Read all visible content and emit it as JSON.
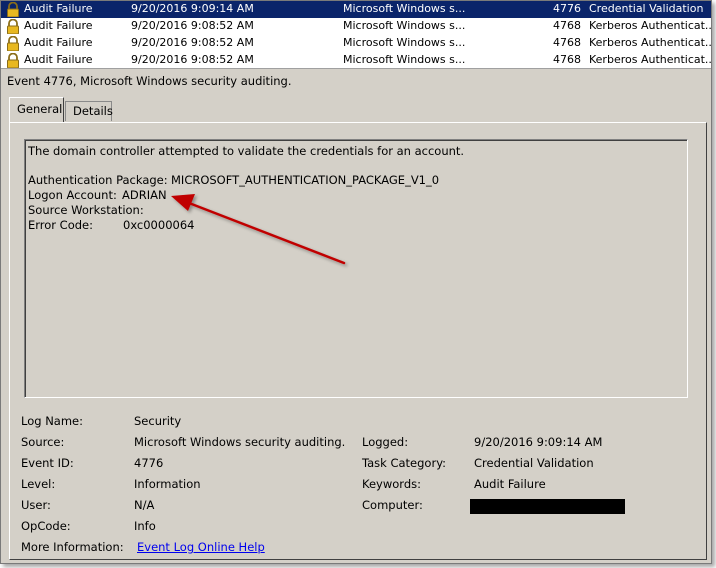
{
  "events": [
    {
      "keywords": "Audit Failure",
      "date": "9/20/2016 9:09:14 AM",
      "source": "Microsoft Windows s...",
      "event_id": "4776",
      "category": "Credential Validation",
      "selected": true
    },
    {
      "keywords": "Audit Failure",
      "date": "9/20/2016 9:08:52 AM",
      "source": "Microsoft Windows s...",
      "event_id": "4768",
      "category": "Kerberos Authenticat...",
      "selected": false
    },
    {
      "keywords": "Audit Failure",
      "date": "9/20/2016 9:08:52 AM",
      "source": "Microsoft Windows s...",
      "event_id": "4768",
      "category": "Kerberos Authenticat...",
      "selected": false
    },
    {
      "keywords": "Audit Failure",
      "date": "9/20/2016 9:08:52 AM",
      "source": "Microsoft Windows s...",
      "event_id": "4768",
      "category": "Kerberos Authenticat...",
      "selected": false
    }
  ],
  "detail_title": "Event 4776, Microsoft Windows security auditing.",
  "tabs": {
    "general": "General",
    "details": "Details"
  },
  "description": {
    "summary": "The domain controller attempted to validate the credentials for an account.",
    "auth_package_label": "Authentication Package:",
    "auth_package_value": "MICROSOFT_AUTHENTICATION_PACKAGE_V1_0",
    "logon_account_label": "Logon Account:",
    "logon_account_value": "ADRIAN",
    "source_workstation_label": "Source Workstation:",
    "source_workstation_value": "",
    "error_code_label": "Error Code:",
    "error_code_value": "0xc0000064"
  },
  "properties": {
    "log_name_label": "Log Name:",
    "log_name": "Security",
    "source_label": "Source:",
    "source": "Microsoft Windows security auditing.",
    "logged_label": "Logged:",
    "logged": "9/20/2016 9:09:14 AM",
    "event_id_label": "Event ID:",
    "event_id": "4776",
    "task_category_label": "Task Category:",
    "task_category": "Credential Validation",
    "level_label": "Level:",
    "level": "Information",
    "keywords_label": "Keywords:",
    "keywords": "Audit Failure",
    "user_label": "User:",
    "user": "N/A",
    "computer_label": "Computer:",
    "opcode_label": "OpCode:",
    "opcode": "Info",
    "more_info_label": "More Information:",
    "more_info_link": "Event Log Online Help"
  },
  "colors": {
    "selection": "#0a246a",
    "arrow": "#c00000",
    "link": "#0000ee"
  }
}
